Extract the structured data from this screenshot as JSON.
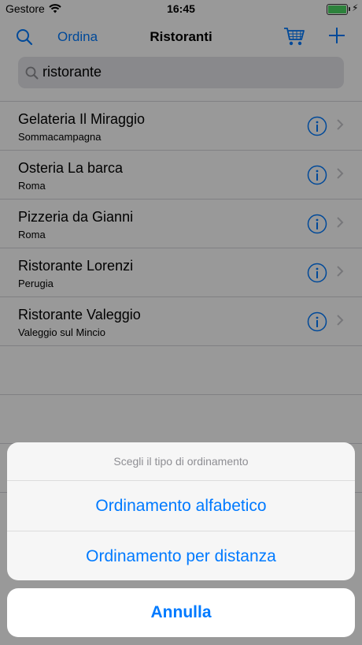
{
  "status_bar": {
    "carrier": "Gestore",
    "time": "16:45"
  },
  "nav": {
    "order_label": "Ordina",
    "title": "Ristoranti"
  },
  "search": {
    "value": "ristorante"
  },
  "restaurants": [
    {
      "name": "Gelateria Il Miraggio",
      "city": "Sommacampagna"
    },
    {
      "name": "Osteria La barca",
      "city": "Roma"
    },
    {
      "name": "Pizzeria da Gianni",
      "city": "Roma"
    },
    {
      "name": "Ristorante Lorenzi",
      "city": "Perugia"
    },
    {
      "name": "Ristorante Valeggio",
      "city": "Valeggio sul Mincio"
    }
  ],
  "action_sheet": {
    "title": "Scegli il tipo di ordinamento",
    "actions": [
      "Ordinamento alfabetico",
      "Ordinamento per distanza"
    ],
    "cancel": "Annulla"
  },
  "icons": {
    "search": "search-icon",
    "cart": "cart-icon",
    "add": "plus-icon",
    "info": "info-icon",
    "chevron": "chevron-right-icon",
    "wifi": "wifi-icon",
    "battery": "battery-icon"
  },
  "colors": {
    "accent": "#007aff",
    "battery": "#4cd964"
  }
}
